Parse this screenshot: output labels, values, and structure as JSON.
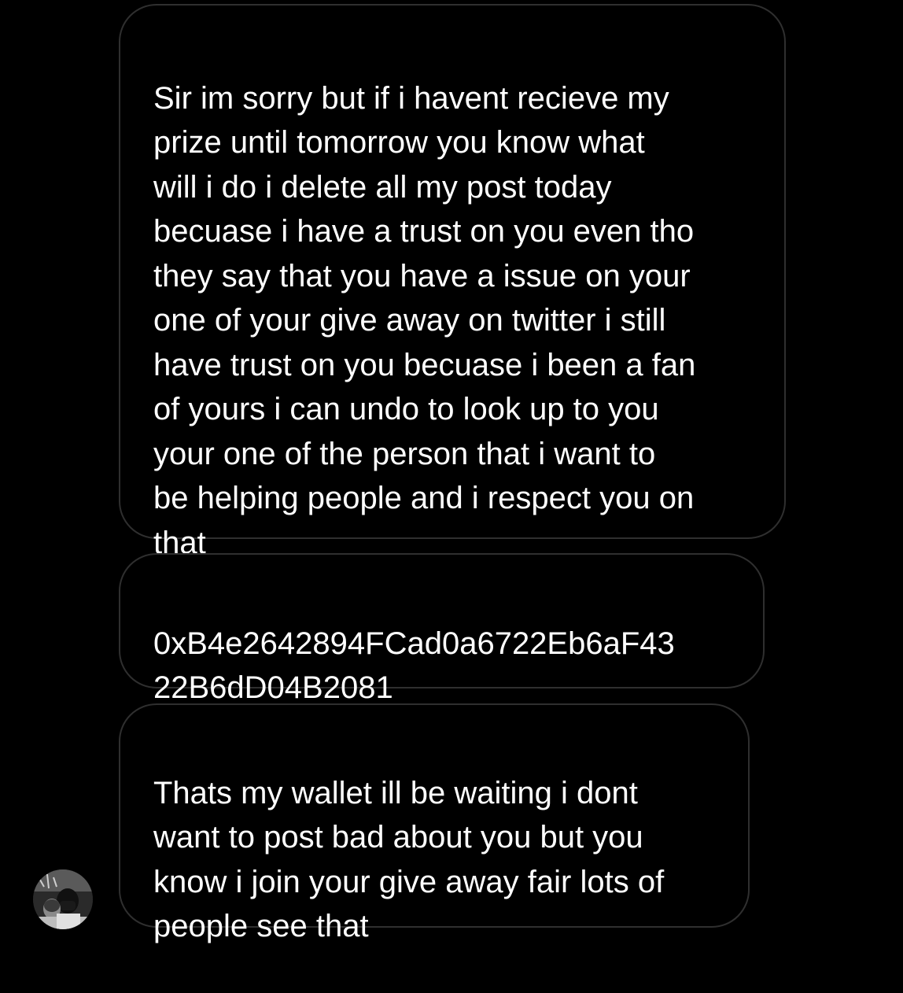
{
  "messages": [
    {
      "text": "Sir im sorry but if i havent recieve my\nprize until tomorrow  you know what\nwill i do i delete all my post today\nbecuase i have a trust on you even tho\nthey say that you have a issue on your\none of your give away on twitter i still\nhave trust on you becuase i been a fan\nof yours i can undo to look up to you\nyour one of the person that i want to\nbe helping people and i respect you on\nthat"
    },
    {
      "text": "0xB4e2642894FCad0a6722Eb6aF43\n22B6dD04B2081"
    },
    {
      "text": "Thats my wallet ill be waiting i dont\nwant to post bad about you but you\nknow i join your give away fair lots of\npeople see that"
    }
  ],
  "sender": {
    "avatar_icon": "profile-photo"
  },
  "colors": {
    "background": "#000000",
    "bubble_border": "#2f2f2f",
    "text": "#ffffff"
  }
}
